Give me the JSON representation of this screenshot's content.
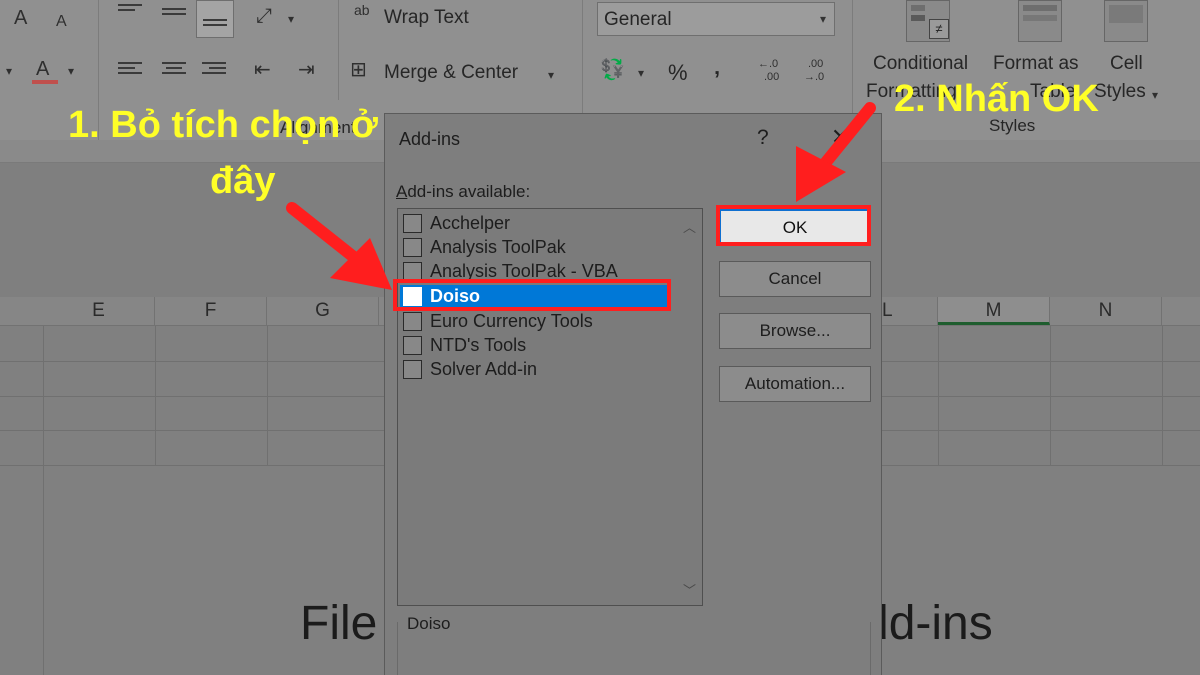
{
  "ribbon": {
    "wrap_text_icon": "ab",
    "wrap_text_label": "Wrap Text",
    "merge_center_label": "Merge & Center",
    "alignment_group_label": "Alignment",
    "number_format_value": "General",
    "percent_symbol": "%",
    "comma_symbol": "‚",
    "increase_decimal_top": "←.0",
    "increase_decimal_bottom": ".00",
    "decrease_decimal_top": ".00",
    "decrease_decimal_bottom": "→.0",
    "conditional_formatting_line1": "Conditional",
    "conditional_formatting_line2": "Formatting",
    "format_as_table_line1": "Format as",
    "format_as_table_line2": "Table",
    "cell_styles_line1": "Cell",
    "cell_styles_line2": "Styles",
    "styles_group_label": "Styles",
    "font_grow_icon": "A",
    "font_shrink_icon": "A"
  },
  "grid": {
    "columns": [
      "E",
      "F",
      "G",
      "L",
      "M",
      "N"
    ],
    "active_column": "M"
  },
  "dialog": {
    "title": "Add-ins",
    "help_button": "?",
    "close_button": "✕",
    "list_label_prefix": "A",
    "list_label_rest": "dd-ins available:",
    "items": [
      {
        "label": "Acchelper",
        "checked": false,
        "selected": false
      },
      {
        "label": "Analysis ToolPak",
        "checked": false,
        "selected": false
      },
      {
        "label": "Analysis ToolPak - VBA",
        "checked": false,
        "selected": false
      },
      {
        "label": "Doiso",
        "checked": false,
        "selected": true
      },
      {
        "label": "Euro Currency Tools",
        "checked": false,
        "selected": false
      },
      {
        "label": "NTD's Tools",
        "checked": false,
        "selected": false
      },
      {
        "label": "Solver Add-in",
        "checked": false,
        "selected": false
      }
    ],
    "buttons": {
      "ok": "OK",
      "cancel": "Cancel",
      "browse": "Browse...",
      "automation": "Automation..."
    },
    "description_title": "Doiso"
  },
  "caption": {
    "left": "File",
    "right": "dd-ins"
  },
  "annotations": {
    "step1_line1": "1. Bỏ tích chọn ở",
    "step1_line2": "đây",
    "step2": "2. Nhấn OK",
    "text_color": "#ffff27",
    "highlight_color": "#ff1e1e"
  }
}
